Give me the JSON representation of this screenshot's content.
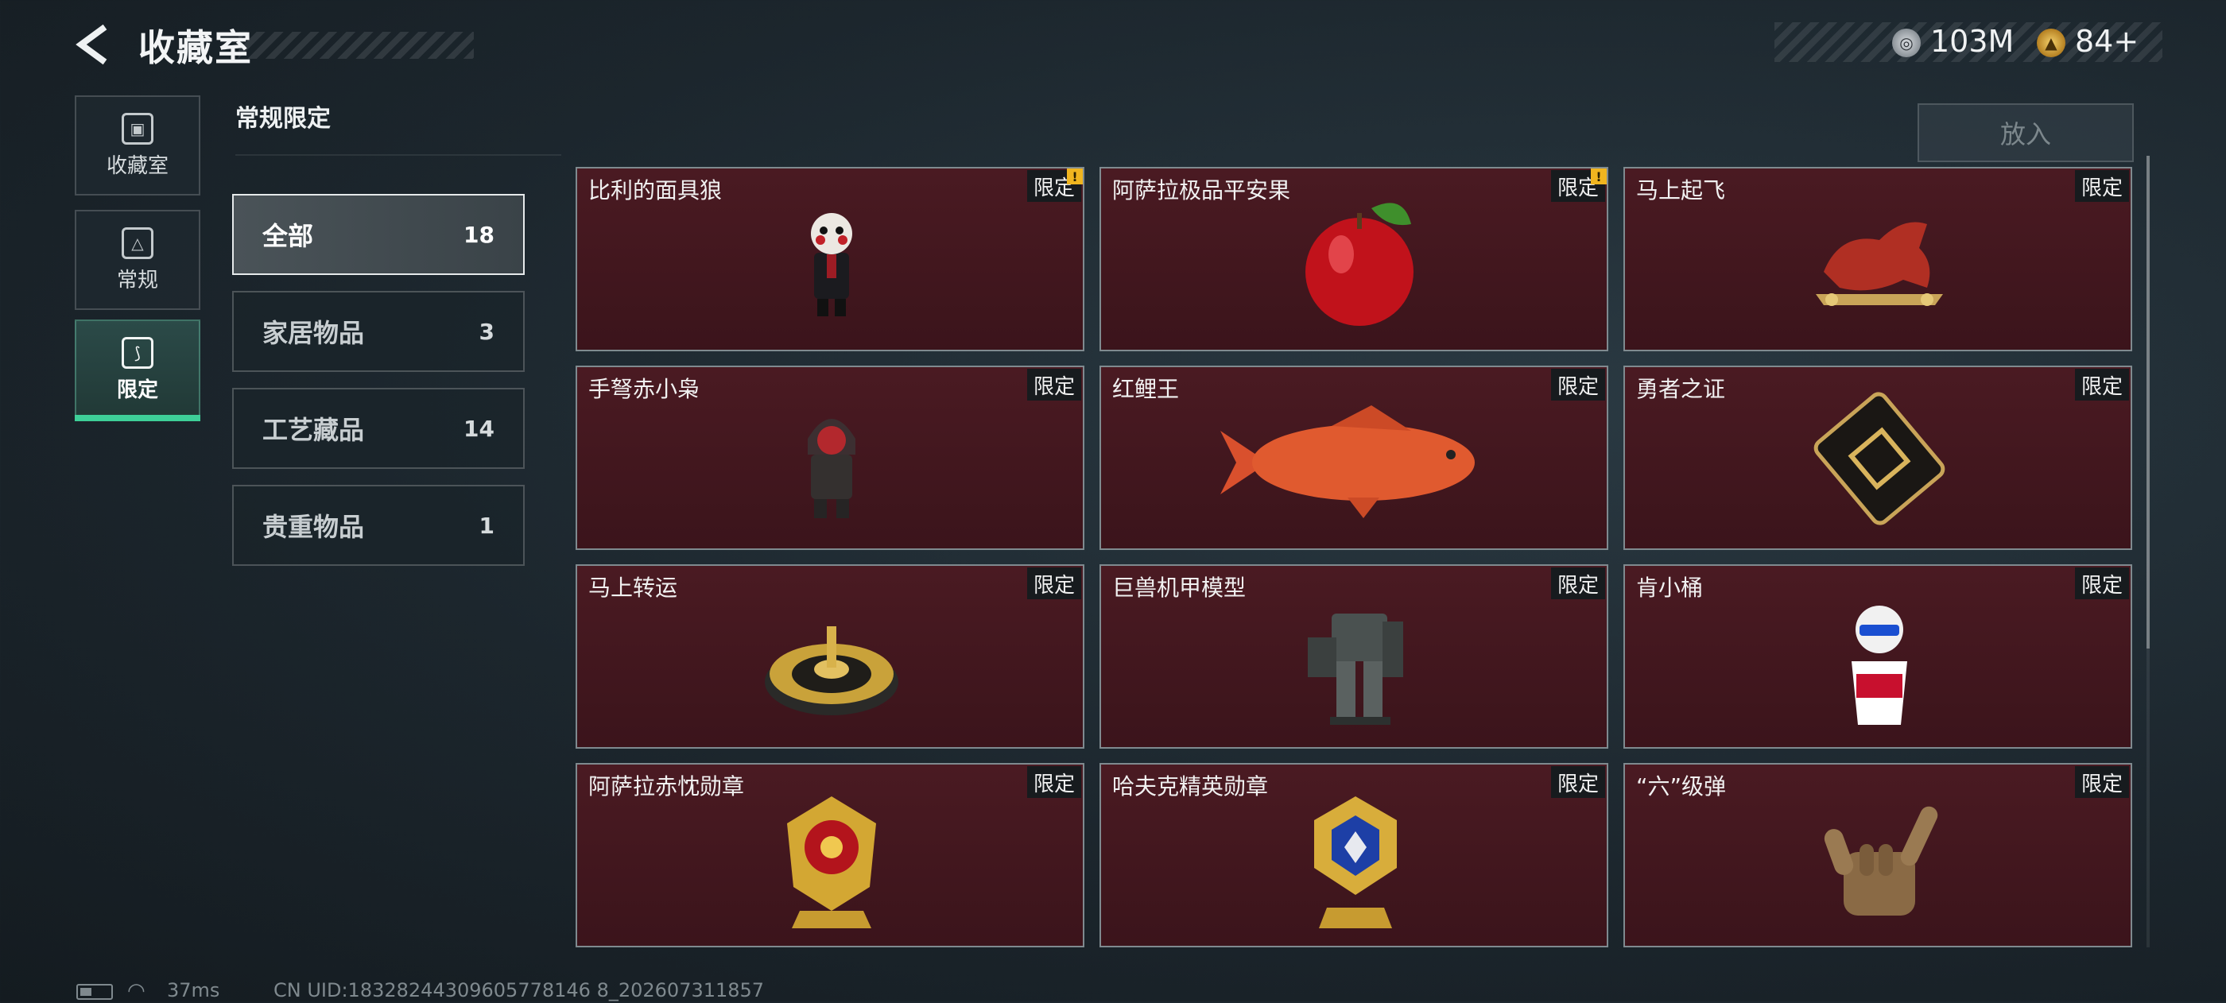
{
  "header": {
    "title": "收藏室",
    "currency": [
      {
        "icon": "silver-coin-icon",
        "value": "103M"
      },
      {
        "icon": "gold-coin-icon",
        "value": "84+"
      }
    ]
  },
  "nav": [
    {
      "label": "收藏室",
      "icon": "collection-icon",
      "active": false
    },
    {
      "label": "常规",
      "icon": "regular-icon",
      "active": false
    },
    {
      "label": "限定",
      "icon": "limited-icon",
      "active": true
    }
  ],
  "section_title": "常规限定",
  "put_button": "放入",
  "categories": [
    {
      "label": "全部",
      "count": "18",
      "selected": true
    },
    {
      "label": "家居物品",
      "count": "3",
      "selected": false
    },
    {
      "label": "工艺藏品",
      "count": "14",
      "selected": false
    },
    {
      "label": "贵重物品",
      "count": "1",
      "selected": false
    }
  ],
  "items": [
    {
      "name": "比利的面具狼",
      "tag": "限定",
      "alert": true,
      "icon": "masked-doll-icon"
    },
    {
      "name": "阿萨拉极品平安果",
      "tag": "限定",
      "alert": true,
      "icon": "red-apple-icon"
    },
    {
      "name": "马上起飞",
      "tag": "限定",
      "alert": false,
      "icon": "red-horse-icon"
    },
    {
      "name": "手弩赤小枭",
      "tag": "限定",
      "alert": false,
      "icon": "hooded-figure-icon"
    },
    {
      "name": "红鲤王",
      "tag": "限定",
      "alert": false,
      "icon": "red-carp-icon"
    },
    {
      "name": "勇者之证",
      "tag": "限定",
      "alert": false,
      "icon": "black-gold-card-icon"
    },
    {
      "name": "马上转运",
      "tag": "限定",
      "alert": false,
      "icon": "gold-spinner-icon"
    },
    {
      "name": "巨兽机甲模型",
      "tag": "限定",
      "alert": false,
      "icon": "mech-model-icon"
    },
    {
      "name": "肯小桶",
      "tag": "限定",
      "alert": false,
      "icon": "bucket-figure-icon"
    },
    {
      "name": "阿萨拉赤忱勋章",
      "tag": "限定",
      "alert": false,
      "icon": "red-gold-medal-icon"
    },
    {
      "name": "哈夫克精英勋章",
      "tag": "限定",
      "alert": false,
      "icon": "blue-gold-medal-icon"
    },
    {
      "name": "“六”级弹",
      "tag": "限定",
      "alert": false,
      "icon": "hand-sign-icon"
    }
  ],
  "alert_mark": "!",
  "status": {
    "ping": "37ms",
    "uid": "CN UID:18328244309605778146 8_202607311857"
  }
}
